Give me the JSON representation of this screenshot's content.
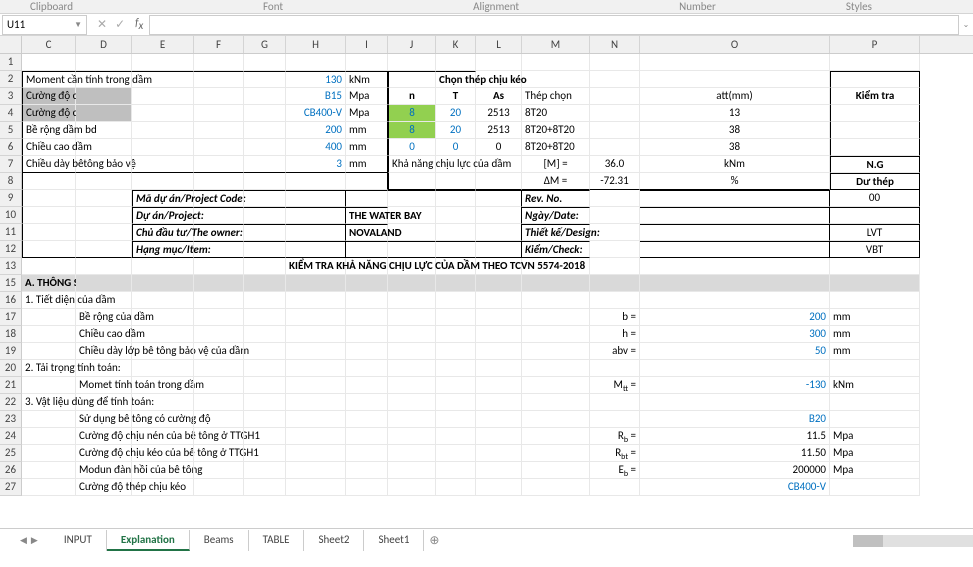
{
  "ribbon_groups": [
    "Clipboard",
    "Font",
    "Alignment",
    "Number",
    "Styles"
  ],
  "namebox": "U11",
  "labels": {
    "r2_C": "Moment cần tính  trong dầm",
    "r2_H": "130",
    "r2_I": "kNm",
    "r2_header": "Chọn thép chịu kéo",
    "r3_C": "Cường độ của bê tông",
    "r3_H": "B15",
    "r3_I": "Mpa",
    "r3_J": "n",
    "r3_K": "T",
    "r3_L": "As",
    "r3_M": "Thép chọn",
    "r3_O": "att(mm)",
    "r3_P": "Kiểm tra",
    "r4_C": "Cường độ của thép",
    "r4_H": "CB400-V",
    "r4_I": "Mpa",
    "r4_J": "8",
    "r4_K": "20",
    "r4_L": "2513",
    "r4_M": "8T20",
    "r4_O": "13",
    "r5_C": "Bề rộng dầm bd",
    "r5_H": "200",
    "r5_I": "mm",
    "r5_J": "8",
    "r5_K": "20",
    "r5_L": "2513",
    "r5_M": "8T20+8T20",
    "r5_O": "38",
    "r6_C": "Chiều cao dầm",
    "r6_H": "400",
    "r6_I": "mm",
    "r6_J": "0",
    "r6_K": "0",
    "r6_L": "0",
    "r6_M": "8T20+8T20",
    "r6_O": "38",
    "r7_C": "Chiều dày bêtông bảo vệ",
    "r7_H": "3",
    "r7_I": "mm",
    "r7_J": "Khả năng chịu lực của dầm",
    "r7_M": "[M] =",
    "r7_N": "36.0",
    "r7_O": "kNm",
    "r7_P": "N.G",
    "r8_M": "ΔM =",
    "r8_N": "-72.31",
    "r8_O": "%",
    "r8_P": "Dư thép",
    "r9_E": "Mã dự án/Project Code:",
    "r9_M": "Rev. No.",
    "r9_P": "00",
    "r10_E": "Dự án/Project:",
    "r10_I": "THE WATER BAY",
    "r10_M": "Ngày/Date:",
    "r11_E": "Chủ đầu tư/The owner:",
    "r11_I": "NOVALAND",
    "r11_M": "Thiết kế/Design:",
    "r11_P": "LVT",
    "r12_E": "Hạng mục/Item:",
    "r12_M": "Kiểm/Check:",
    "r12_P": "VBT",
    "r13": "KIỂM TRA KHẢ NĂNG CHỊU LỰC CỦA DẦM THEO TCVN 5574-2018",
    "r15": "A. THÔNG SỐ ĐẦU VÀO",
    "r16": "1. Tiết diện của dầm",
    "r17_D": "Bề rộng của dầm",
    "r17_N": "b =",
    "r17_O": "200",
    "r17_P": "mm",
    "r18_D": "Chiều cao dầm",
    "r18_N": "h =",
    "r18_O": "300",
    "r18_P": "mm",
    "r19_D": "Chiều dày lớp bê tông bảo vệ của dầm",
    "r19_N": "abv =",
    "r19_O": "50",
    "r19_P": "mm",
    "r20": "2. Tải trọng tính toán:",
    "r21_D": "Momet tính toán trong dầm",
    "r21_N": "M",
    "r21_Nsub": "tt",
    "r21_Neq": " =",
    "r21_O": "-130",
    "r21_P": "kNm",
    "r22": "3. Vật liệu dùng để tính toán:",
    "r23_D": "Sử dụng bê tông có cường độ",
    "r23_O": "B20",
    "r24_D": "Cường độ chịu nén của bê tông ở TTGH1",
    "r24_N": "R",
    "r24_Nsub": "b",
    "r24_Neq": " =",
    "r24_O": "11.5",
    "r24_P": "Mpa",
    "r25_D": "Cường độ chịu kéo của bê tông ở TTGH1",
    "r25_N": "R",
    "r25_Nsub": "bt",
    "r25_Neq": " =",
    "r25_O": "11.50",
    "r25_P": "Mpa",
    "r26_D": "Modun đàn hồi của bê tông",
    "r26_N": "E",
    "r26_Nsub": "b",
    "r26_Neq": " =",
    "r26_O": "200000",
    "r26_P": "Mpa",
    "r27_D": "Cường độ thép chịu kéo",
    "r27_O": "CB400-V"
  },
  "columns": [
    "C",
    "D",
    "E",
    "F",
    "G",
    "H",
    "I",
    "J",
    "K",
    "L",
    "M",
    "N",
    "O",
    "P"
  ],
  "rows": [
    1,
    2,
    3,
    4,
    5,
    6,
    7,
    8,
    9,
    10,
    11,
    12,
    13,
    15,
    16,
    17,
    18,
    19,
    20,
    21,
    22,
    23,
    24,
    25,
    26,
    27
  ],
  "tabs": [
    "INPUT",
    "Explanation",
    "Beams",
    "TABLE",
    "Sheet2",
    "Sheet1"
  ],
  "active_tab": "Explanation"
}
